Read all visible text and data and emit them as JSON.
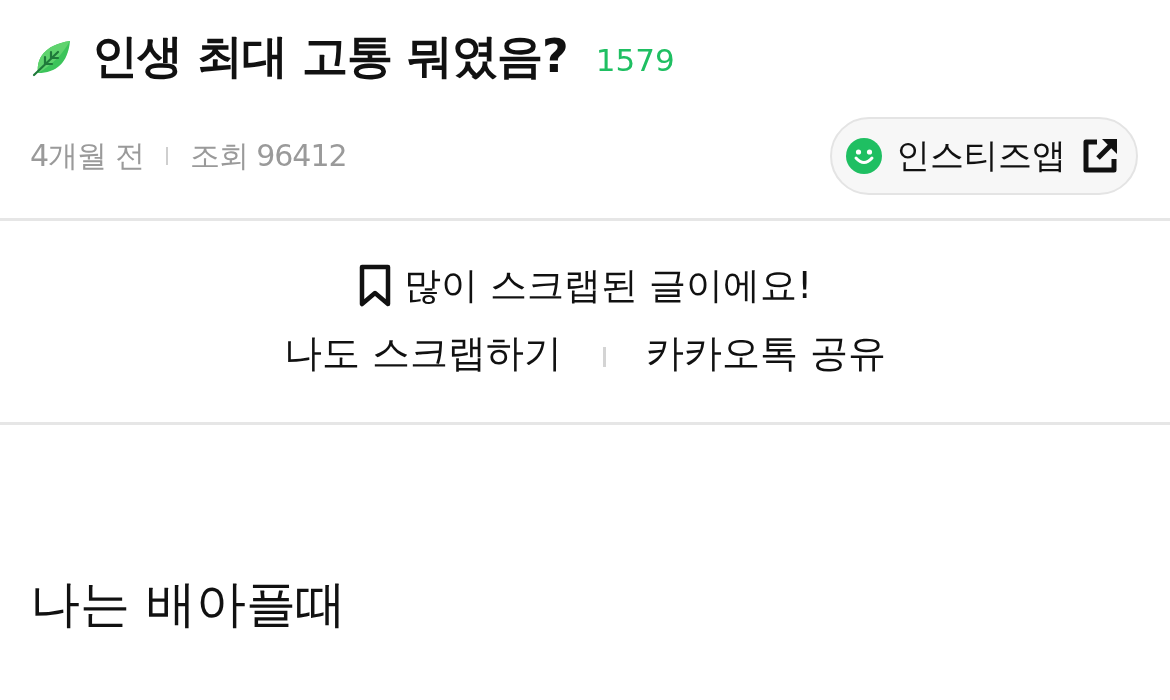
{
  "post": {
    "title": "인생 최대 고통 뭐였음?",
    "comment_count": "1579",
    "time": "4개월 전",
    "views": "조회 96412",
    "app_button": "인스티즈앱"
  },
  "scrap": {
    "message": "많이 스크랩된 글이에요!",
    "actions": [
      "나도 스크랩하기",
      "카카오톡 공유"
    ]
  },
  "body": {
    "text": "나는 배아플때"
  }
}
